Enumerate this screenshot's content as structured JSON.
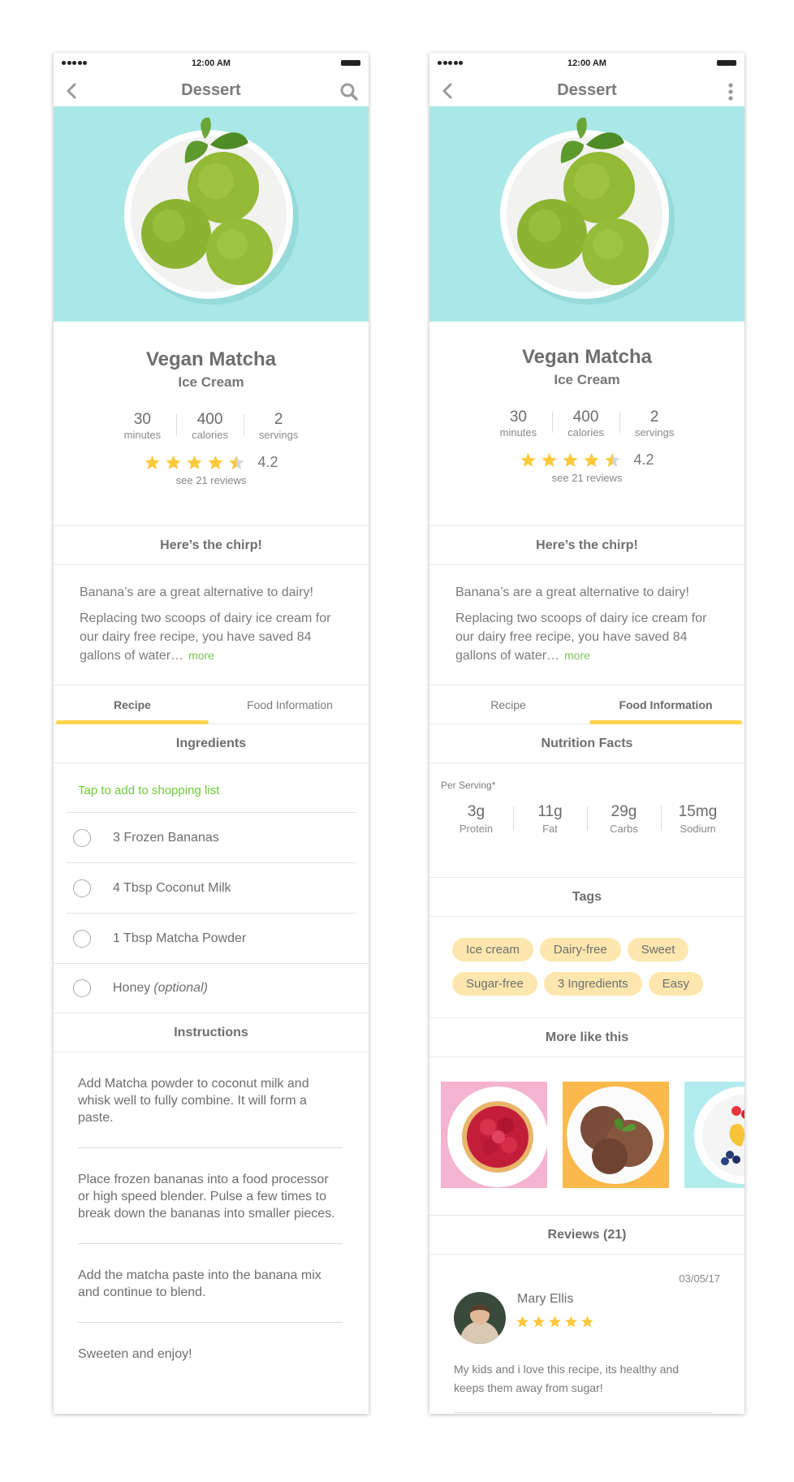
{
  "status_bar": {
    "time": "12:00 AM"
  },
  "left_screen": {
    "nav": {
      "title": "Dessert",
      "back_icon": "chevron-left-icon",
      "action_icon": "search-icon"
    },
    "recipe": {
      "title": "Vegan Matcha",
      "subtitle": "Ice Cream",
      "stats": [
        {
          "value": "30",
          "label": "minutes"
        },
        {
          "value": "400",
          "label": "calories"
        },
        {
          "value": "2",
          "label": "servings"
        }
      ],
      "rating": "4.2",
      "rating_fraction": 0.84,
      "reviews_link": "see 21 reviews"
    },
    "chirp": {
      "header": "Here’s the chirp!",
      "line1": "Banana’s are a great alternative to dairy!",
      "line2": "Replacing two scoops of dairy ice cream for our dairy free recipe, you have saved 84 gallons of water…",
      "more": "more"
    },
    "tabs": [
      {
        "label": "Recipe",
        "active": true
      },
      {
        "label": "Food Information",
        "active": false
      }
    ],
    "ingredients": {
      "header": "Ingredients",
      "shopping_link": "Tap to add to shopping list",
      "items": [
        {
          "text": "3 Frozen Bananas"
        },
        {
          "text": "4 Tbsp Coconut Milk"
        },
        {
          "text": "1 Tbsp Matcha Powder"
        },
        {
          "text": "Honey",
          "note": "(optional)"
        }
      ]
    },
    "instructions": {
      "header": "Instructions",
      "steps": [
        "Add Matcha powder to coconut milk and whisk well to fully combine. It will form a paste.",
        "Place frozen bananas into a food processor or high speed blender. Pulse a few times to break down the bananas into smaller pieces.",
        "Add the matcha paste into the banana mix and continue to blend.",
        "Sweeten and enjoy!"
      ]
    }
  },
  "right_screen": {
    "nav": {
      "title": "Dessert",
      "back_icon": "chevron-left-icon",
      "action_icon": "more-vertical-icon"
    },
    "recipe": {
      "title": "Vegan Matcha",
      "subtitle": "Ice Cream",
      "stats": [
        {
          "value": "30",
          "label": "minutes"
        },
        {
          "value": "400",
          "label": "calories"
        },
        {
          "value": "2",
          "label": "servings"
        }
      ],
      "rating": "4.2",
      "rating_fraction": 0.84,
      "reviews_link": "see 21 reviews"
    },
    "chirp": {
      "header": "Here’s the chirp!",
      "line1": "Banana’s are a great alternative to dairy!",
      "line2": "Replacing two scoops of dairy ice cream for our dairy free recipe, you have saved 84 gallons of water…",
      "more": "more"
    },
    "tabs": [
      {
        "label": "Recipe",
        "active": false
      },
      {
        "label": "Food Information",
        "active": true
      }
    ],
    "nutrition": {
      "header": "Nutrition Facts",
      "per_serving": "Per Serving*",
      "items": [
        {
          "value": "3g",
          "label": "Protein"
        },
        {
          "value": "11g",
          "label": "Fat"
        },
        {
          "value": "29g",
          "label": "Carbs"
        },
        {
          "value": "15mg",
          "label": "Sodium"
        }
      ]
    },
    "tags": {
      "header": "Tags",
      "items": [
        "Ice cream",
        "Dairy-free",
        "Sweet",
        "Sugar-free",
        "3 Ingredients",
        "Easy"
      ]
    },
    "more_like_this": {
      "header": "More like this",
      "items": [
        "raspberry-tart-image",
        "chocolate-ice-cream-image",
        "fruit-plate-image"
      ]
    },
    "reviews": {
      "header": "Reviews (21)",
      "items": [
        {
          "name": "Mary Ellis",
          "date": "03/05/17",
          "stars": 5,
          "text": "My kids and i love this recipe, its healthy and keeps them away from sugar!"
        }
      ]
    }
  },
  "colors": {
    "hero_background": "#a9e8e7",
    "accent_yellow": "#fbd54b",
    "star": "#fcc93c",
    "link_green": "#6fca3b",
    "tag_background": "#fde7ae"
  }
}
